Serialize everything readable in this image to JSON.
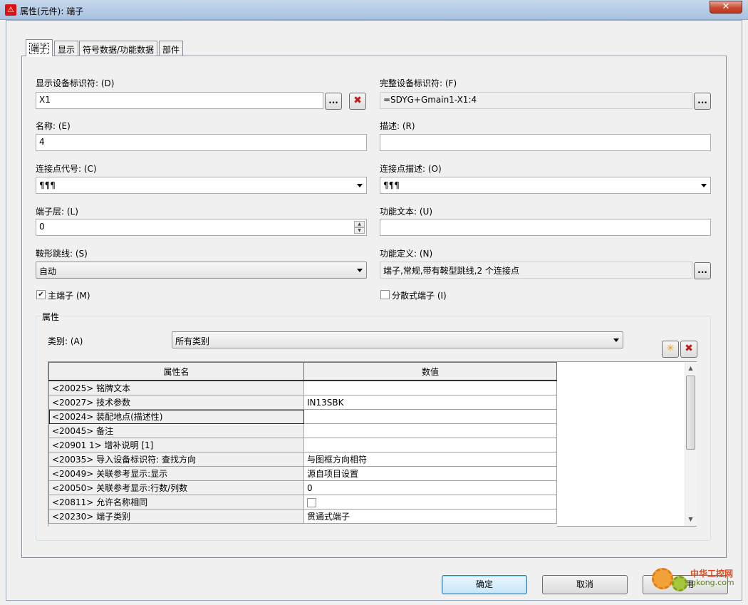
{
  "window": {
    "title": "属性(元件): 端子",
    "close_glyph": "✕"
  },
  "tabs": [
    {
      "label": "端子",
      "active": true
    },
    {
      "label": "显示"
    },
    {
      "label": "符号数据/功能数据"
    },
    {
      "label": "部件"
    }
  ],
  "form": {
    "display_id_label": "显示设备标识符: (D)",
    "display_id_value": "X1",
    "full_id_label": "完整设备标识符: (F)",
    "full_id_value": "=SDYG+Gmain1-X1:4",
    "name_label": "名称: (E)",
    "name_value": "4",
    "desc_label": "描述: (R)",
    "desc_value": "",
    "conn_code_label": "连接点代号: (C)",
    "conn_code_value": "¶¶¶",
    "conn_desc_label": "连接点描述: (O)",
    "conn_desc_value": "¶¶¶",
    "terminal_level_label": "端子层: (L)",
    "terminal_level_value": "0",
    "func_text_label": "功能文本: (U)",
    "func_text_value": "",
    "jumper_label": "鞍形跳线: (S)",
    "jumper_value": "自动",
    "func_def_label": "功能定义: (N)",
    "func_def_value": "端子,常规,带有鞍型跳线,2 个连接点",
    "main_terminal_label": "主端子 (M)",
    "main_terminal_checked": true,
    "dist_terminal_label": "分散式端子 (I)",
    "dist_terminal_checked": false,
    "browse_glyph": "...",
    "delete_glyph": "✖"
  },
  "properties": {
    "group_title": "属性",
    "category_label": "类别: (A)",
    "category_value": "所有类别",
    "new_glyph": "✳",
    "delete_glyph": "✖",
    "columns": [
      "属性名",
      "数值"
    ],
    "rows": [
      {
        "name": "<20025> 铭牌文本",
        "value": ""
      },
      {
        "name": "<20027> 技术参数",
        "value": "IN13SBK"
      },
      {
        "name": "<20024> 装配地点(描述性)",
        "value": ""
      },
      {
        "name": "<20045> 备注",
        "value": ""
      },
      {
        "name": "<20901 1> 增补说明 [1]",
        "value": ""
      },
      {
        "name": "<20035> 导入设备标识符: 查找方向",
        "value": "与图框方向相符"
      },
      {
        "name": "<20049> 关联参考显示:显示",
        "value": "源自项目设置"
      },
      {
        "name": "<20050> 关联参考显示:行数/列数",
        "value": "0"
      },
      {
        "name": "<20811> 允许名称相同",
        "value": ""
      },
      {
        "name": "<20230> 端子类别",
        "value": "贯通式端子"
      }
    ]
  },
  "buttons": {
    "ok": "确定",
    "cancel": "取消",
    "apply": "应用"
  },
  "watermark": {
    "line1": "中华工控网",
    "line2": "gkong.com"
  }
}
